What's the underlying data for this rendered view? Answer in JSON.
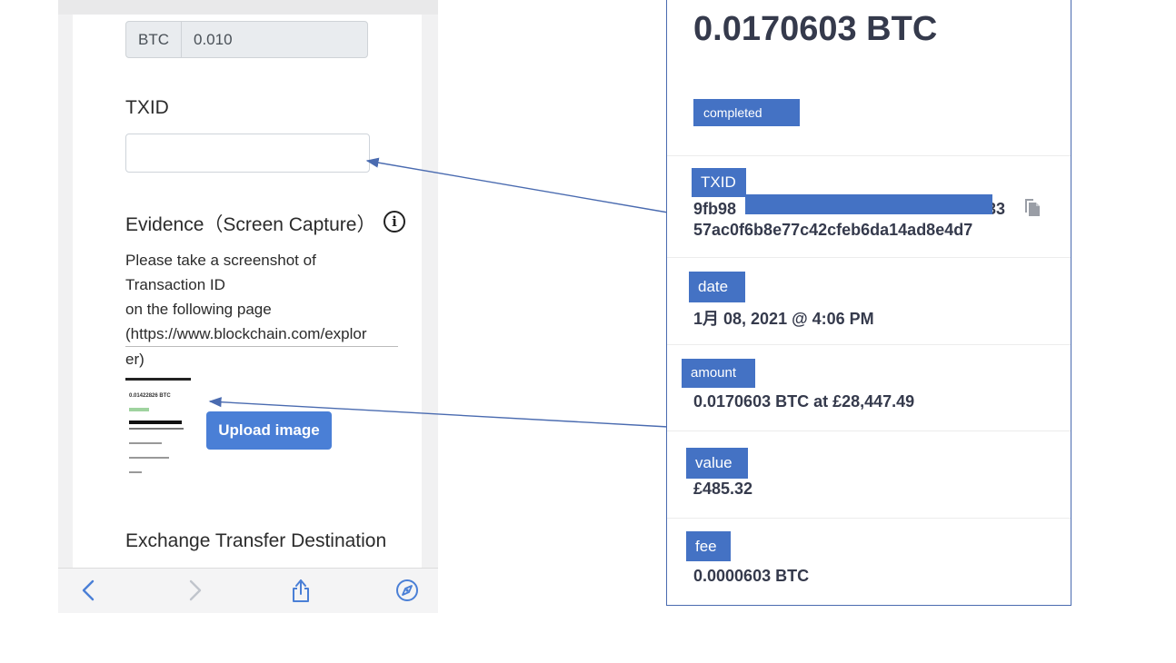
{
  "phone": {
    "amount_currency": "BTC",
    "amount_value": "0.010",
    "txid_label": "TXID",
    "txid_value": "",
    "evidence_title": "Evidence（Screen Capture）",
    "evidence_desc_lines": [
      "Please take a screenshot of",
      "Transaction ID",
      "on the following page",
      "(https://www.blockchain.com/explor",
      "er)"
    ],
    "upload_button": "Upload image",
    "exchange_title": "Exchange Transfer Destination",
    "thumbnail_text": "0.01422826 BTC",
    "toolbar_icons": [
      "back-icon",
      "forward-icon",
      "share-icon",
      "compass-icon"
    ]
  },
  "panel": {
    "amount": "0.0170603 BTC",
    "status": "completed",
    "txid_label": "TXID",
    "txid_line1_start": "9fb98",
    "txid_line1_end": "33",
    "txid_line2": "57ac0f6b8e77c42cfeb6da14ad8e4d7",
    "date_label": "date",
    "date_value": "1月 08, 2021 @ 4:06 PM",
    "amount_label": "amount",
    "amount_value": "0.0170603 BTC at £28,447.49",
    "value_label": "value",
    "value_value": "£485.32",
    "fee_label": "fee",
    "fee_value": "0.0000603 BTC"
  },
  "colors": {
    "accent": "#4472c4",
    "button": "#4a7fd6",
    "arrow": "#4a6bb0"
  }
}
